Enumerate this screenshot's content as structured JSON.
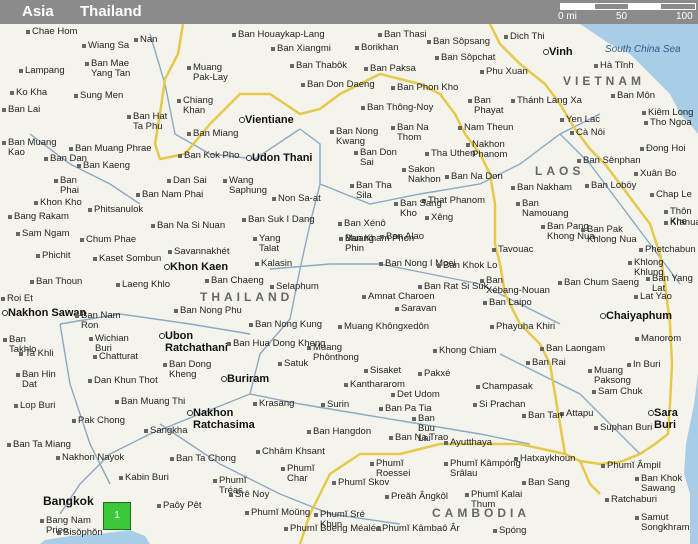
{
  "breadcrumb": {
    "region": "Asia",
    "country": "Thailand"
  },
  "scale": {
    "labels": [
      "0 mi",
      "50",
      "100"
    ]
  },
  "colors": {
    "land": "#f5f4ec",
    "sea": "#a9cde6",
    "border": "#e6c84a",
    "road": "#8aa9c4",
    "topbar": "#8b8b8b"
  },
  "map": {
    "countries": [
      "THAILAND",
      "LAOS",
      "VIETNAM",
      "CAMBODIA"
    ],
    "sea": "South China Sea",
    "big_city": "Bangkok",
    "zoom_button": "1",
    "labels": [
      "Chae Hom",
      "Nan",
      "Ban Houaykap-Lang",
      "Ban Thasi",
      "Ban Sôpsang",
      "Dich Thi",
      "Vinh",
      "Wiang Sa",
      "Ban Xiangmi",
      "Borikhan",
      "Ban Sôpchat",
      "Lampang",
      "Ban Mae\nYang Tan",
      "Muang\nPak-Lay",
      "Ban Thabôk",
      "Ban Paksa",
      "Phu Xuan",
      "Hà Tĩnh",
      "Ko Kha",
      "Sung Men",
      "Ban Don Daeng",
      "Ban Phon Kho",
      "Ban\nPhayat",
      "Ban Lai",
      "Chiang\nKhan",
      "Vientiane",
      "Ban Thông-Noy",
      "Thánh Lang Xa",
      "Ban Môn",
      "Kiêm Long",
      "Ban Hat\nTa Phu",
      "Yen Lac",
      "Tho Ngoa",
      "Ban Miang",
      "Ban Nong\nKwang",
      "Ban Na\nThom",
      "Nam Theun",
      "Cà Nôi",
      "Ban Muang\nKao",
      "Ban Muang Phrae",
      "Ban Kok Pho",
      "Udon Thani",
      "Ban Don\nSai",
      "Tha Uthen",
      "Nakhon\nPhanom",
      "Đong Hoi",
      "Ban Dan",
      "Ban Kaeng",
      "Sakon\nNakhon",
      "Ban Sênphan",
      "Ban\nPhai",
      "Dan Sai",
      "Ban Na Don",
      "Xuân Bo",
      "Ban Tha\nSila",
      "Ban Nakham",
      "Ban Loböy",
      "Khon Kho",
      "Ban Nam Phai",
      "Wang\nSaphung",
      "Non Sa-at",
      "That Phanom",
      "Chap Le",
      "Phitsanulok",
      "Ban Sang\nKho",
      "Ban\nNamouang",
      "Thôn Khe",
      "Bang Rakam",
      "Ban Suk I Dang",
      "Ban Xénô",
      "Xêng",
      "Ban Pang\nKhong Nua",
      "Kranuan",
      "Ban Na Si Nuan",
      "Muang\nPhin",
      "Ban Pak\nKhlong Nua",
      "Sam Ngam",
      "Chum Phae",
      "Yang\nTalat",
      "Ban Kham Phon",
      "Ban Alao",
      "Phetchabun",
      "Savannakhét",
      "Tavouac",
      "Khlong\nKhlung",
      "Phichit",
      "Kaset Sombun",
      "Khon Kaen",
      "Kalasin",
      "Ban Nong I Moei",
      "Ban Khok Lo",
      "Ban Thoun",
      "Ban Yang\nLat",
      "Laeng Khlo",
      "Ban Chaeng",
      "Selaphum",
      "Ban Rat Si Suk",
      "Ban\nXébang-Nouan",
      "Ban Chum Saeng",
      "Roi Et",
      "Amnat Charoen",
      "Ban Laipo",
      "Lat Yao",
      "Nakhon Sawan",
      "Ban Nam\nRon",
      "Ban Nong Phu",
      "Saravan",
      "Chaiyaphum",
      "Ban Nong Kung",
      "Muang Khôngxedôn",
      "Phayuha Khiri",
      "Ban\nTakhlo",
      "Wichian\nBuri",
      "Ubon\nRatchathani",
      "Khong Chiam",
      "Ban Laongam",
      "Manorom",
      "Ta Khli",
      "Chatturat",
      "Ban Hua Dong Kheng",
      "Muang\nPhônthong",
      "Ban Rai",
      "Ban Hin\nDat",
      "Ban Dong\nKheng",
      "Satuk",
      "Sisaket",
      "Pakxé",
      "Muang\nPaksong",
      "In Buri",
      "Dan Khun Thot",
      "Buriram",
      "Kanthararom",
      "Champasak",
      "Sam Chuk",
      "Lop Buri",
      "Ban Muang Thi",
      "Det Udom",
      "Si Prachan",
      "Pak Chong",
      "Nakhon\nRatchasima",
      "Krasang",
      "Surin",
      "Ban Pa Tia",
      "Attapu",
      "Sara Buri",
      "Sangkha",
      "Ban\nBuu\nLai",
      "Ban Tan",
      "Ban Hangdon",
      "Suphan Buri",
      "Ban Ta Miang",
      "Ban Na Trao",
      "Ayutthaya",
      "Nakhon Nayok",
      "Ban Ta Chong",
      "Chhâm Khsant",
      "Hatxaykhoun",
      "Phumĭ Âmpil",
      "Phumĭ\nChar",
      "Phumĭ\nRoessei",
      "Phumĭ Kâmpóng\nSrâlau",
      "Ban Sang",
      "Kabin Buri",
      "Phumĭ\nTréas",
      "Phumĭ Skov",
      "Phumĭ Kalai\nThum",
      "Ban Khok Sawang",
      "Srê Noy",
      "Preăh Ângkôl",
      "Ratchaburi",
      "Bang Nam\nPrieo",
      "Paôy Pêt",
      "Phumĭ Moŭng",
      "Phumĭ Sré\nKhun",
      "Samut Songkhram",
      "Sisŏphŏn",
      "Phumĭ Boeng Méaléa",
      "Phumĭ Kâmbaô Âr",
      "Spóng"
    ]
  }
}
